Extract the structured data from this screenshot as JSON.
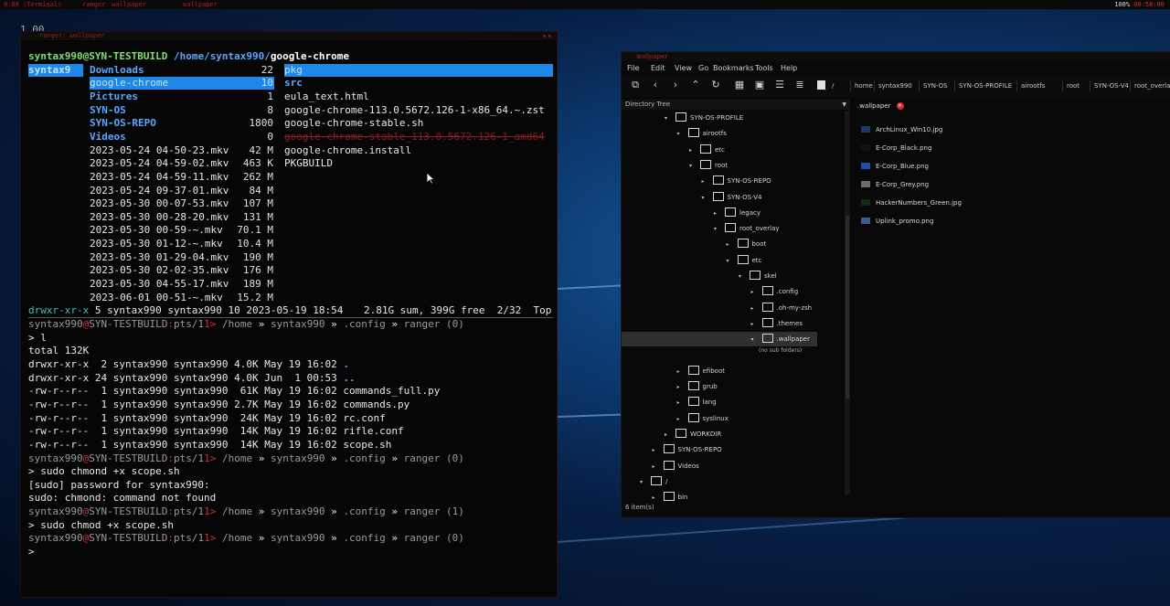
{
  "taskbar": {
    "tags": [
      "0:00 (Terminal)",
      "ranger",
      "wallpaper"
    ],
    "active_tag": "wallpaper",
    "battery": "100%",
    "clock": "00:58:00"
  },
  "desktop": {
    "workspace_number": "1.00"
  },
  "terminal": {
    "title": "ranger: wallpaper",
    "header": {
      "user_host": "syntax990@SYN-TESTBUILD",
      "path": "/home/syntax990/",
      "current": "google-chrome"
    },
    "parent_col": "syntax9",
    "middle": [
      {
        "name": "Downloads",
        "count": "22",
        "type": "dir"
      },
      {
        "name": "google-chrome",
        "count": "10",
        "type": "dir",
        "selected": true
      },
      {
        "name": "Pictures",
        "count": "1",
        "type": "dir"
      },
      {
        "name": "SYN-OS",
        "count": "8",
        "type": "dir"
      },
      {
        "name": "SYN-OS-REPO",
        "count": "1800",
        "type": "dir"
      },
      {
        "name": "Videos",
        "count": "0",
        "type": "dir"
      },
      {
        "name": "2023-05-24 04-50-23.mkv",
        "count": "42 M",
        "type": "file"
      },
      {
        "name": "2023-05-24 04-59-02.mkv",
        "count": "463 K",
        "type": "file"
      },
      {
        "name": "2023-05-24 04-59-11.mkv",
        "count": "262 M",
        "type": "file"
      },
      {
        "name": "2023-05-24 09-37-01.mkv",
        "count": "84 M",
        "type": "file"
      },
      {
        "name": "2023-05-30 00-07-53.mkv",
        "count": "107 M",
        "type": "file"
      },
      {
        "name": "2023-05-30 00-28-20.mkv",
        "count": "131 M",
        "type": "file"
      },
      {
        "name": "2023-05-30 00-59-~.mkv",
        "count": "70.1 M",
        "type": "file"
      },
      {
        "name": "2023-05-30 01-12-~.mkv",
        "count": "10.4 M",
        "type": "file"
      },
      {
        "name": "2023-05-30 01-29-04.mkv",
        "count": "190 M",
        "type": "file"
      },
      {
        "name": "2023-05-30 02-02-35.mkv",
        "count": "176 M",
        "type": "file"
      },
      {
        "name": "2023-05-30 04-55-17.mkv",
        "count": "189 M",
        "type": "file"
      },
      {
        "name": "2023-06-01 00-51-~.mkv",
        "count": "15.2 M",
        "type": "file"
      }
    ],
    "right": [
      {
        "name": "pkg",
        "type": "dir",
        "selected": true
      },
      {
        "name": "src",
        "type": "dir"
      },
      {
        "name": "eula_text.html",
        "type": "file"
      },
      {
        "name": "google-chrome-113.0.5672.126-1-x86_64.~.zst",
        "type": "file"
      },
      {
        "name": "google-chrome-stable.sh",
        "type": "file"
      },
      {
        "name": "google-chrome-stable_113.0.5672.126-1_amd64",
        "type": "deleted"
      },
      {
        "name": "google-chrome.install",
        "type": "file"
      },
      {
        "name": "PKGBUILD",
        "type": "file"
      }
    ],
    "statusline": {
      "perms": "drwxr-xr-x",
      "info": " 5 syntax990 syntax990 10 2023-05-19 18:54",
      "disk": "2.81G sum, 399G free",
      "pos": "2/32",
      "where": "Top"
    },
    "prompt": {
      "user": "syntax990",
      "host": "SYN-TESTBUILD",
      "tty": "pts/1",
      "home": "/home",
      "sep": "»"
    },
    "session": [
      {
        "kind": "prompt",
        "dir": ".config",
        "prog": "ranger",
        "code": "(0)"
      },
      {
        "kind": "cmd",
        "text": "> l"
      },
      {
        "kind": "out",
        "text": "total 132K"
      },
      {
        "kind": "ls",
        "perm": "drwxr-xr-x",
        "links": " 2",
        "meta": "syntax990 syntax990 4.0K May 19 16:02",
        "name": ".",
        "dir": true
      },
      {
        "kind": "ls",
        "perm": "drwxr-xr-x",
        "links": "24",
        "meta": "syntax990 syntax990 4.0K Jun  1 00:53",
        "name": "..",
        "dir": true
      },
      {
        "kind": "ls",
        "perm": "-rw-r--r--",
        "links": " 1",
        "meta": "syntax990 syntax990  61K May 19 16:02",
        "name": "commands_full.py"
      },
      {
        "kind": "ls",
        "perm": "-rw-r--r--",
        "links": " 1",
        "meta": "syntax990 syntax990 2.7K May 19 16:02",
        "name": "commands.py"
      },
      {
        "kind": "ls",
        "perm": "-rw-r--r--",
        "links": " 1",
        "meta": "syntax990 syntax990  24K May 19 16:02",
        "name": "rc.conf"
      },
      {
        "kind": "ls",
        "perm": "-rw-r--r--",
        "links": " 1",
        "meta": "syntax990 syntax990  14K May 19 16:02",
        "name": "rifle.conf"
      },
      {
        "kind": "ls",
        "perm": "-rw-r--r--",
        "links": " 1",
        "meta": "syntax990 syntax990  14K May 19 16:02",
        "name": "scope.sh"
      },
      {
        "kind": "prompt",
        "dir": ".config",
        "prog": "ranger",
        "code": "(0)"
      },
      {
        "kind": "cmd",
        "text": "> sudo chmond +x scope.sh"
      },
      {
        "kind": "out",
        "text": "[sudo] password for syntax990:"
      },
      {
        "kind": "out",
        "text": "sudo: chmond: command not found"
      },
      {
        "kind": "prompt",
        "dir": ".config",
        "prog": "ranger",
        "code": "(1)"
      },
      {
        "kind": "cmd",
        "text": "> sudo chmod +x scope.sh"
      },
      {
        "kind": "prompt",
        "dir": ".config",
        "prog": "ranger",
        "code": "(0)"
      },
      {
        "kind": "cmd",
        "text": ">"
      }
    ]
  },
  "file_manager": {
    "title": "wallpaper",
    "menu": [
      "File",
      "Edit",
      "View",
      "Go",
      "Bookmarks",
      "Tools",
      "Help"
    ],
    "breadcrumbs": [
      "/",
      "home",
      "syntax990",
      "SYN-OS",
      "SYN-OS-PROFILE",
      "airootfs",
      "root",
      "SYN-OS-V4",
      "root_overlay"
    ],
    "tree_header": "Directory Tree",
    "tree": [
      {
        "label": "SYN-OS-PROFILE",
        "depth": 2,
        "arrow": "▾"
      },
      {
        "label": "airootfs",
        "depth": 3,
        "arrow": "▾"
      },
      {
        "label": "etc",
        "depth": 4,
        "arrow": "▸"
      },
      {
        "label": "root",
        "depth": 4,
        "arrow": "▾"
      },
      {
        "label": "SYN-OS-REPO",
        "depth": 5,
        "arrow": "▸"
      },
      {
        "label": "SYN-OS-V4",
        "depth": 5,
        "arrow": "▾"
      },
      {
        "label": "legacy",
        "depth": 6,
        "arrow": "▸"
      },
      {
        "label": "root_overlay",
        "depth": 6,
        "arrow": "▾"
      },
      {
        "label": "boot",
        "depth": 7,
        "arrow": "▸"
      },
      {
        "label": "etc",
        "depth": 7,
        "arrow": "▾"
      },
      {
        "label": "skel",
        "depth": 8,
        "arrow": "▾"
      },
      {
        "label": ".config",
        "depth": 9,
        "arrow": "▸"
      },
      {
        "label": ".oh-my-zsh",
        "depth": 9,
        "arrow": "▸"
      },
      {
        "label": ".themes",
        "depth": 9,
        "arrow": "▸"
      },
      {
        "label": ".wallpaper",
        "depth": 9,
        "arrow": "▾",
        "selected": true
      },
      {
        "label": "(no sub folders)",
        "depth": 10,
        "arrow": "",
        "note": true
      },
      {
        "label": "efiboot",
        "depth": 3,
        "arrow": "▸"
      },
      {
        "label": "grub",
        "depth": 3,
        "arrow": "▸"
      },
      {
        "label": "lang",
        "depth": 3,
        "arrow": "▸"
      },
      {
        "label": "syslinux",
        "depth": 3,
        "arrow": "▸"
      },
      {
        "label": "WORKDIR",
        "depth": 2,
        "arrow": "▸"
      },
      {
        "label": "SYN-OS-REPO",
        "depth": 1,
        "arrow": "▸"
      },
      {
        "label": "Videos",
        "depth": 1,
        "arrow": "▸"
      },
      {
        "label": "/",
        "depth": 0,
        "arrow": "▾"
      },
      {
        "label": "bin",
        "depth": 1,
        "arrow": "▸"
      }
    ],
    "status": "6 item(s)",
    "tab": ".wallpaper",
    "files": [
      {
        "name": "ArchLinux_Win10.jpg",
        "thumb": "#1b3a66"
      },
      {
        "name": "E-Corp_Black.png",
        "thumb": "#111111"
      },
      {
        "name": "E-Corp_Blue.png",
        "thumb": "#1d4fa8"
      },
      {
        "name": "E-Corp_Grey.png",
        "thumb": "#6c6c6c"
      },
      {
        "name": "HackerNumbers_Green.jpg",
        "thumb": "#0d2a12"
      },
      {
        "name": "Uplink_promo.png",
        "thumb": "#3a5c8a"
      }
    ]
  }
}
